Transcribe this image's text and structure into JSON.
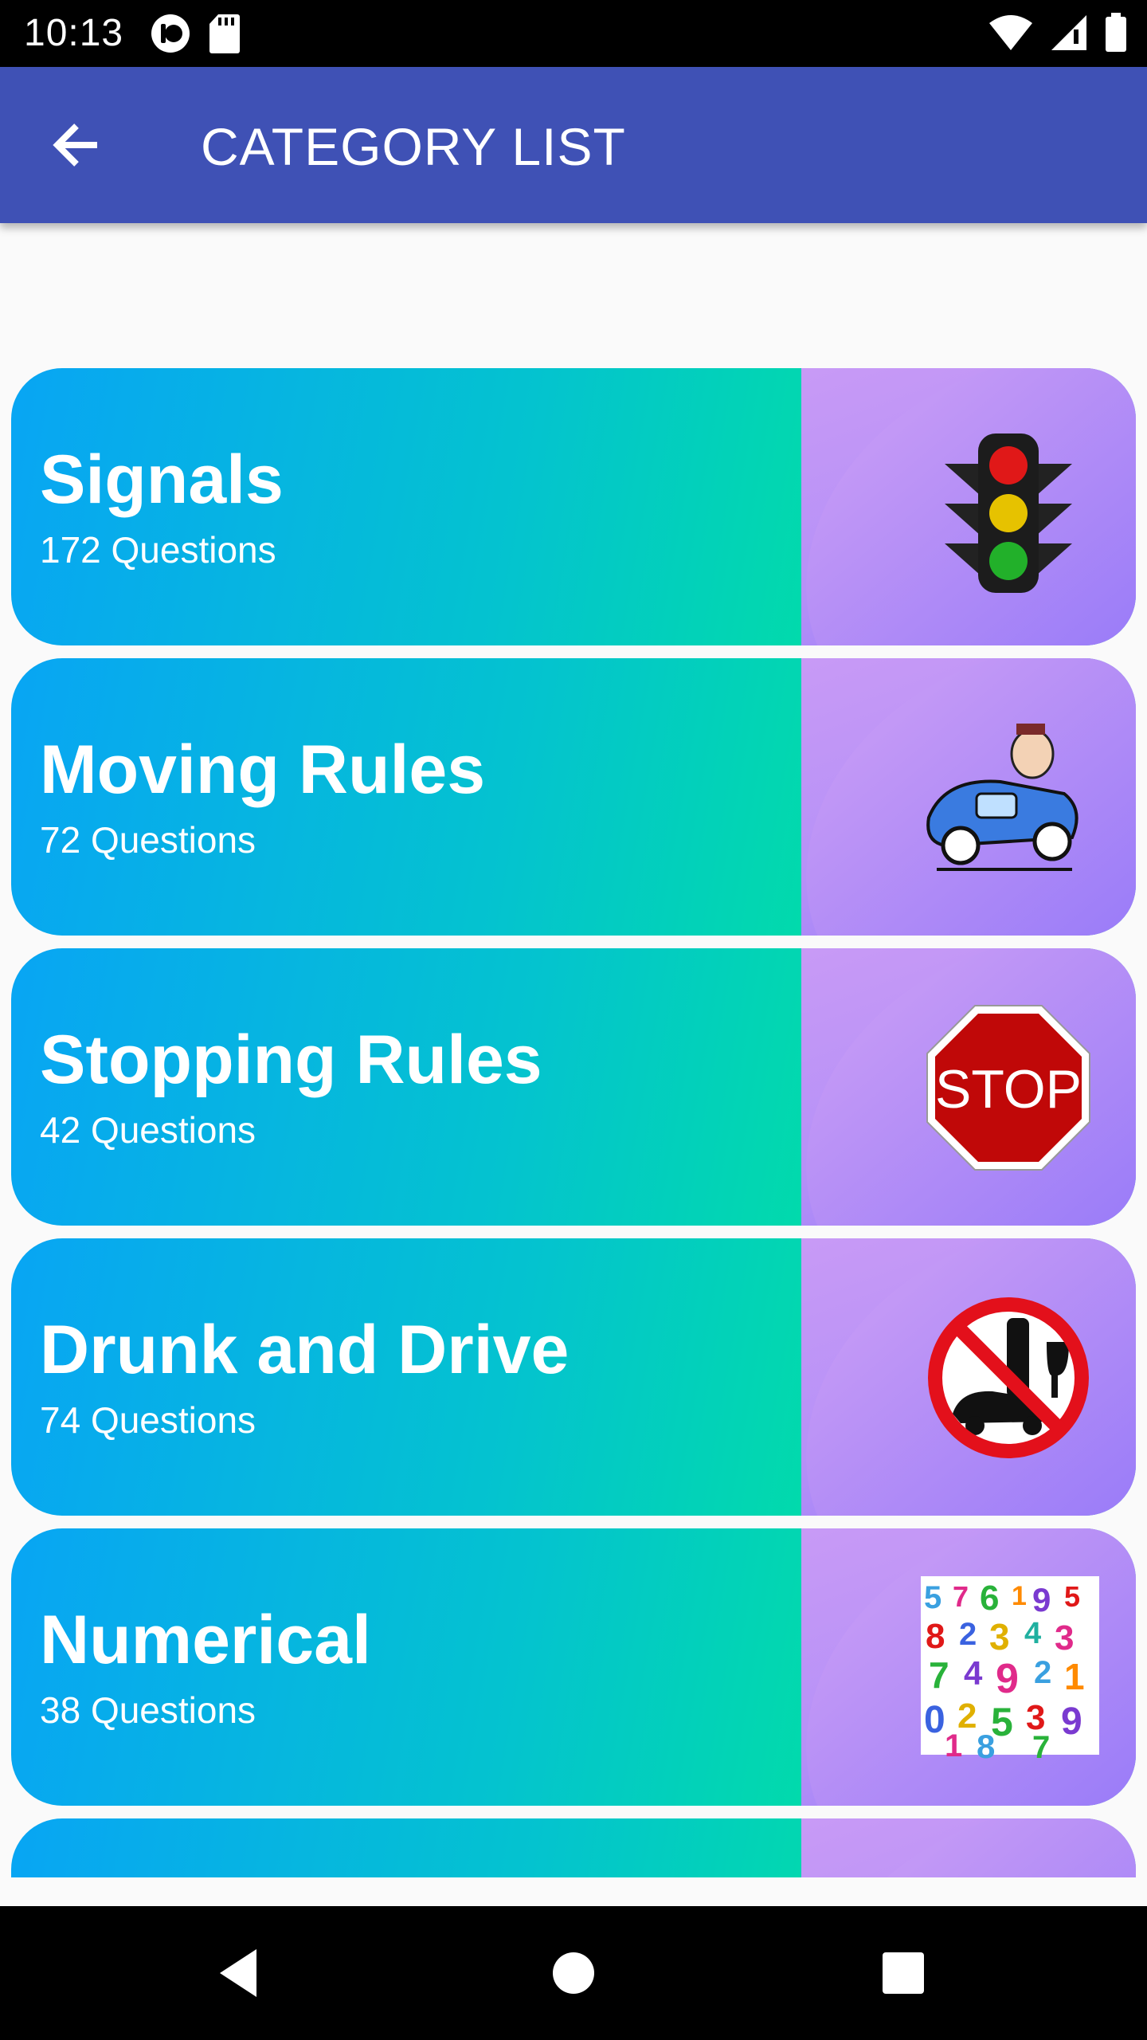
{
  "status_bar": {
    "time": "10:13"
  },
  "app_bar": {
    "title": "CATEGORY LIST"
  },
  "categories": [
    {
      "title": "Signals",
      "count": "172 Questions",
      "icon": "traffic-light-icon"
    },
    {
      "title": "Moving Rules",
      "count": "72 Questions",
      "icon": "car-driver-icon"
    },
    {
      "title": "Stopping Rules",
      "count": "42 Questions",
      "icon": "stop-sign-icon"
    },
    {
      "title": "Drunk and Drive",
      "count": "74 Questions",
      "icon": "no-drink-driving-icon"
    },
    {
      "title": "Numerical",
      "count": "38 Questions",
      "icon": "numbers-icon"
    },
    {
      "title": "",
      "count": "",
      "icon": ""
    }
  ],
  "colors": {
    "app_bar": "#3f51b5",
    "card_start": "#08a5f4",
    "card_end": "#00e39e",
    "blob": "#b691f7"
  }
}
